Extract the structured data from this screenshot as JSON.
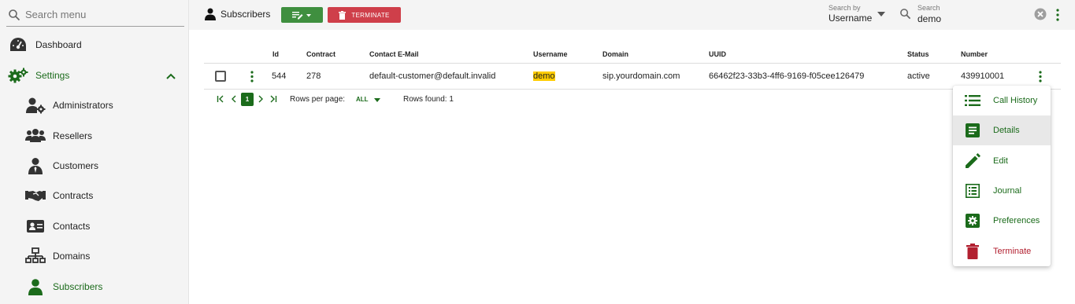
{
  "sidebar": {
    "search_placeholder": "Search menu",
    "items": [
      {
        "label": "Dashboard",
        "icon": "dashboard-icon"
      },
      {
        "label": "Settings",
        "icon": "gears-icon"
      },
      {
        "label": "Administrators",
        "icon": "admin-gear-icon"
      },
      {
        "label": "Resellers",
        "icon": "people-group-icon"
      },
      {
        "label": "Customers",
        "icon": "person-tie-icon"
      },
      {
        "label": "Contracts",
        "icon": "handshake-icon"
      },
      {
        "label": "Contacts",
        "icon": "contact-card-icon"
      },
      {
        "label": "Domains",
        "icon": "sitemap-icon"
      },
      {
        "label": "Subscribers",
        "icon": "person-icon"
      }
    ]
  },
  "toolbar": {
    "title": "Subscribers",
    "terminate_label": "TERMINATE",
    "search_by_label": "Search by",
    "search_by_value": "Username",
    "search_label": "Search",
    "search_value": "demo"
  },
  "table": {
    "columns": [
      "Id",
      "Contract",
      "Contact E-Mail",
      "Username",
      "Domain",
      "UUID",
      "Status",
      "Number"
    ],
    "rows": [
      {
        "id": "544",
        "contract": "278",
        "email": "default-customer@default.invalid",
        "username": "demo",
        "domain": "sip.yourdomain.com",
        "uuid": "66462f23-33b3-4ff6-9169-f05cee126479",
        "status": "active",
        "number": "439910001"
      }
    ]
  },
  "pagination": {
    "current_page": "1",
    "rows_per_page_label": "Rows per page:",
    "rows_per_page_value": "ALL",
    "rows_found": "Rows found: 1"
  },
  "row_menu": {
    "items": [
      {
        "label": "Call History",
        "icon": "list-icon"
      },
      {
        "label": "Details",
        "icon": "document-icon"
      },
      {
        "label": "Edit",
        "icon": "pencil-icon"
      },
      {
        "label": "Journal",
        "icon": "journal-list-icon"
      },
      {
        "label": "Preferences",
        "icon": "gear-box-icon"
      },
      {
        "label": "Terminate",
        "icon": "trash-icon"
      }
    ]
  },
  "colors": {
    "primary": "#1b6b1b",
    "button_green": "#3f8f3f",
    "button_red": "#cf3f4a",
    "highlight": "#ffcc00",
    "danger": "#b22030"
  }
}
